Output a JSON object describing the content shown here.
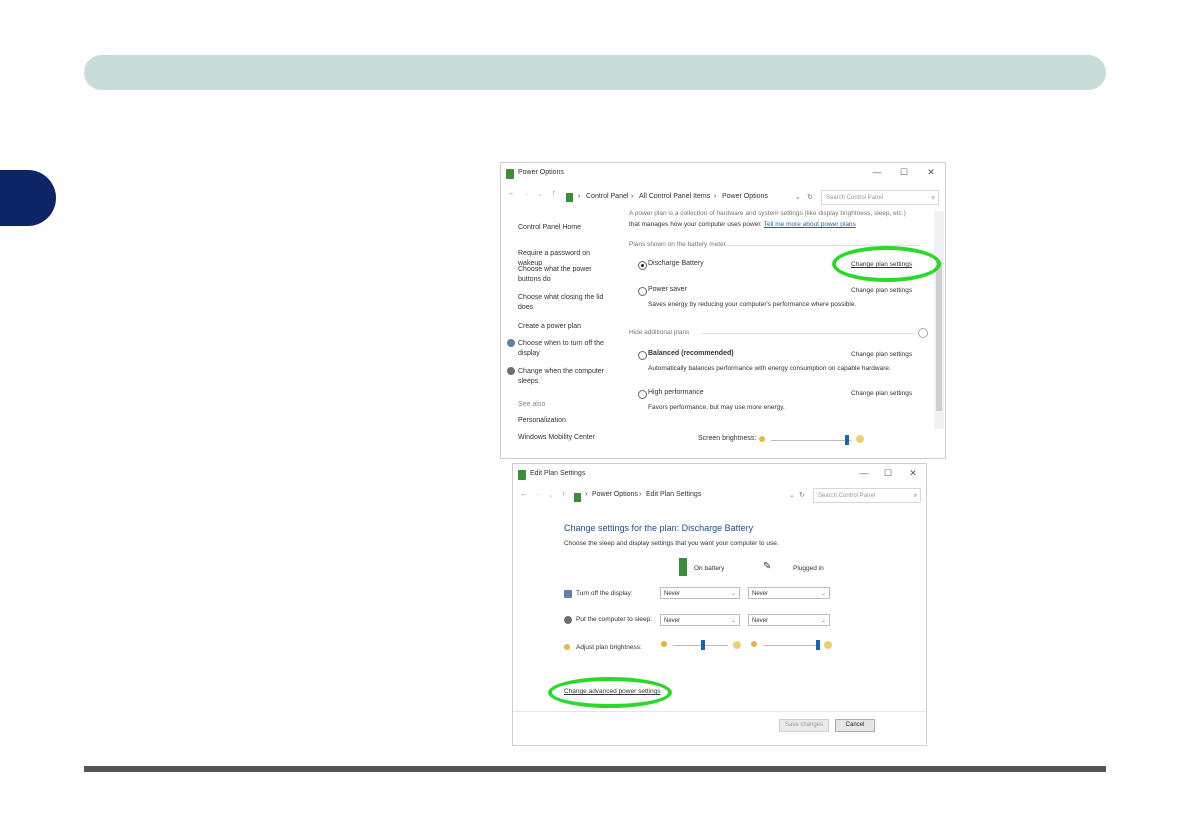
{
  "colors": {
    "header_bar": "#c8ddd9",
    "side_tab": "#0d2466",
    "highlight": "#2bd92b",
    "link": "#1a64b8"
  },
  "power_options": {
    "title": "Power Options",
    "window_controls": {
      "minimize": "—",
      "maximize": "☐",
      "close": "✕"
    },
    "breadcrumb": [
      "Control Panel",
      "All Control Panel Items",
      "Power Options"
    ],
    "search_placeholder": "Search Control Panel",
    "sidebar": {
      "home": "Control Panel Home",
      "items": [
        "Require a password on wakeup",
        "Choose what the power buttons do",
        "Choose what closing the lid does",
        "Create a power plan",
        "Choose when to turn off the display",
        "Change when the computer sleeps"
      ],
      "see_also_label": "See also",
      "see_also": [
        "Personalization",
        "Windows Mobility Center"
      ]
    },
    "intro_line1": "A power plan is a collection of hardware and system settings (like display brightness, sleep, etc.)",
    "intro_line2": "that manages how your computer uses power.",
    "intro_link": "Tell me more about power plans",
    "battery_meter_header": "Plans shown on the battery meter",
    "hide_plans_header": "Hide additional plans",
    "plans": [
      {
        "name": "Discharge Battery",
        "selected": true,
        "link": "Change plan settings",
        "desc": ""
      },
      {
        "name": "Power saver",
        "selected": false,
        "link": "Change plan settings",
        "desc": "Saves energy by reducing your computer's performance where possible."
      },
      {
        "name": "Balanced (recommended)",
        "selected": false,
        "link": "Change plan settings",
        "desc": "Automatically balances performance with energy consumption on capable hardware."
      },
      {
        "name": "High performance",
        "selected": false,
        "link": "Change plan settings",
        "desc": "Favors performance, but may use more energy."
      }
    ],
    "screen_brightness_label": "Screen brightness:",
    "screen_brightness_value": 0.95
  },
  "edit_plan": {
    "title": "Edit Plan Settings",
    "window_controls": {
      "minimize": "—",
      "maximize": "☐",
      "close": "✕"
    },
    "breadcrumb": [
      "Power Options",
      "Edit Plan Settings"
    ],
    "search_placeholder": "Search Control Panel",
    "heading": "Change settings for the plan: Discharge Battery",
    "subheading": "Choose the sleep and display settings that you want your computer to use.",
    "col_on_battery": "On battery",
    "col_plugged_in": "Plugged in",
    "rows": [
      {
        "label": "Turn off the display:",
        "on_battery": "Never",
        "plugged_in": "Never"
      },
      {
        "label": "Put the computer to sleep:",
        "on_battery": "Never",
        "plugged_in": "Never"
      }
    ],
    "brightness_label": "Adjust plan brightness:",
    "brightness_on_battery": 0.55,
    "brightness_plugged_in": 0.95,
    "advanced_link": "Change advanced power settings",
    "save_button": "Save changes",
    "cancel_button": "Cancel"
  }
}
